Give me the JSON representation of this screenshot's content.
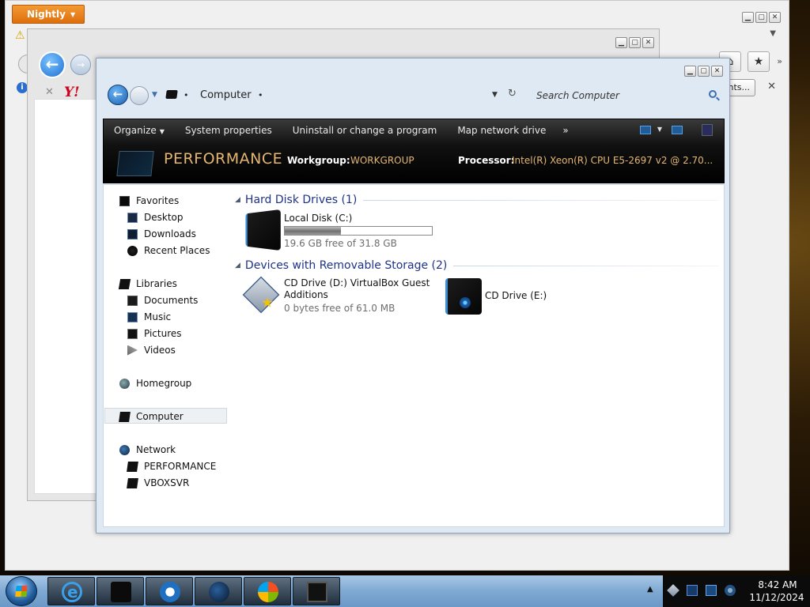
{
  "firefox": {
    "app_button": "Nightly",
    "bookmark_button": "ghts...",
    "yahoo_logo": "Y!"
  },
  "explorer": {
    "address": {
      "location": "Computer",
      "search_placeholder": "Search Computer"
    },
    "toolbar": {
      "organize": "Organize",
      "system_properties": "System properties",
      "uninstall": "Uninstall or change a program",
      "map_drive": "Map network drive",
      "more": "»"
    },
    "details": {
      "computer_name": "PERFORMANCE",
      "workgroup_label": "Workgroup:",
      "workgroup_value": "WORKGROUP",
      "processor_label": "Processor:",
      "processor_value": "Intel(R) Xeon(R) CPU E5-2697 v2 @ 2.70..."
    },
    "nav": {
      "favorites": "Favorites",
      "desktop": "Desktop",
      "downloads": "Downloads",
      "recent_places": "Recent Places",
      "libraries": "Libraries",
      "documents": "Documents",
      "music": "Music",
      "pictures": "Pictures",
      "videos": "Videos",
      "homegroup": "Homegroup",
      "computer": "Computer",
      "network": "Network",
      "net_performance": "PERFORMANCE",
      "net_vboxsvr": "VBOXSVR"
    },
    "groups": {
      "hdd_title": "Hard Disk Drives (1)",
      "removable_title": "Devices with Removable Storage (2)"
    },
    "drives": {
      "c_name": "Local Disk (C:)",
      "c_space": "19.6 GB free of 31.8 GB",
      "c_used_fraction": 0.38,
      "d_name_line1": "CD Drive (D:) VirtualBox Guest",
      "d_name_line2": "Additions",
      "d_space": "0 bytes free of 61.0 MB",
      "e_name": "CD Drive (E:)"
    }
  },
  "taskbar": {
    "time": "8:42 AM",
    "date": "11/12/2024"
  },
  "colors": {
    "accent_gold": "#e4b672",
    "group_header_blue": "#1e3287",
    "nightly_orange": "#e8821e"
  }
}
